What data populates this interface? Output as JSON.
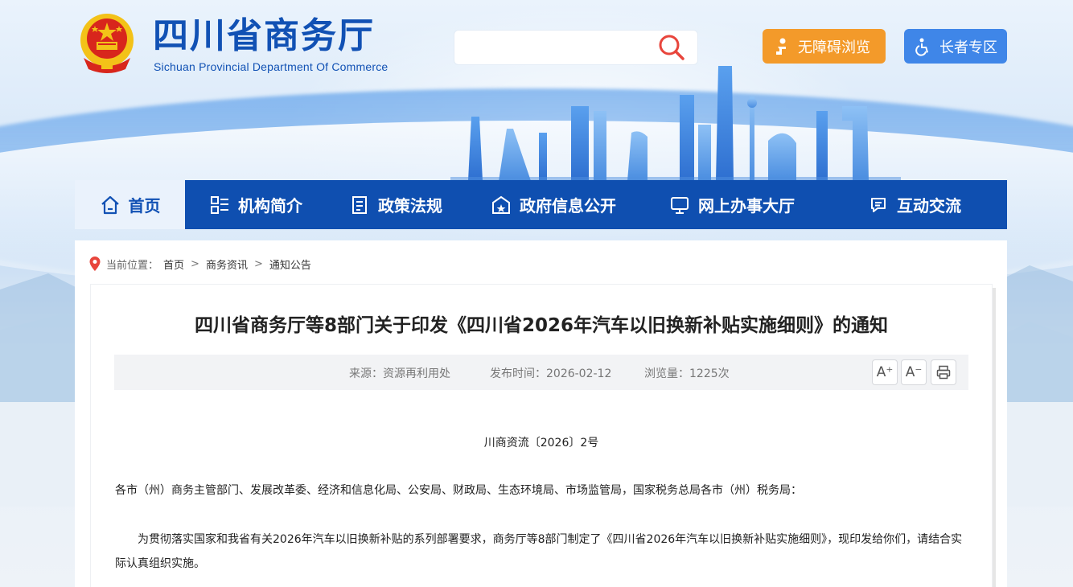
{
  "header": {
    "title": "四川省商务厅",
    "subtitle": "Sichuan Provincial Department Of Commerce",
    "search": {
      "placeholder": "",
      "value": ""
    },
    "accessibility_label": "无障碍浏览",
    "elder_label": "长者专区"
  },
  "nav": {
    "items": [
      {
        "label": "首页",
        "icon": "home-icon"
      },
      {
        "label": "机构简介",
        "icon": "org-list-icon"
      },
      {
        "label": "政策法规",
        "icon": "document-icon"
      },
      {
        "label": "政府信息公开",
        "icon": "building-icon"
      },
      {
        "label": "网上办事大厅",
        "icon": "monitor-icon"
      },
      {
        "label": "互动交流",
        "icon": "chat-icon"
      }
    ]
  },
  "breadcrumb": {
    "label": "当前位置：",
    "items": [
      "首页",
      "商务资讯",
      "通知公告"
    ],
    "separator": ">"
  },
  "article": {
    "title": "四川省商务厅等8部门关于印发《四川省2026年汽车以旧换新补贴实施细则》的通知",
    "source": "来源：资源再利用处",
    "date": "发布时间：2026-02-12",
    "views": "浏览量：1225次",
    "font_larger": "A⁺",
    "font_smaller": "A⁻",
    "doc_number": "川商资流〔2026〕2号",
    "recipients": "各市（州）商务主管部门、发展改革委、经济和信息化局、公安局、财政局、生态环境局、市场监管局，国家税务总局各市（州）税务局：",
    "body_1": "为贯彻落实国家和我省有关2026年汽车以旧换新补贴的系列部署要求，商务厅等8部门制定了《四川省2026年汽车以旧换新补贴实施细则》，现印发给你们，请结合实际认真组织实施。"
  },
  "colors": {
    "primary": "#0f4fb0",
    "title_blue": "#1151b4",
    "accessibility_orange": "#f39a2a",
    "elder_blue": "#3f86e8",
    "search_red": "#e8453c"
  }
}
